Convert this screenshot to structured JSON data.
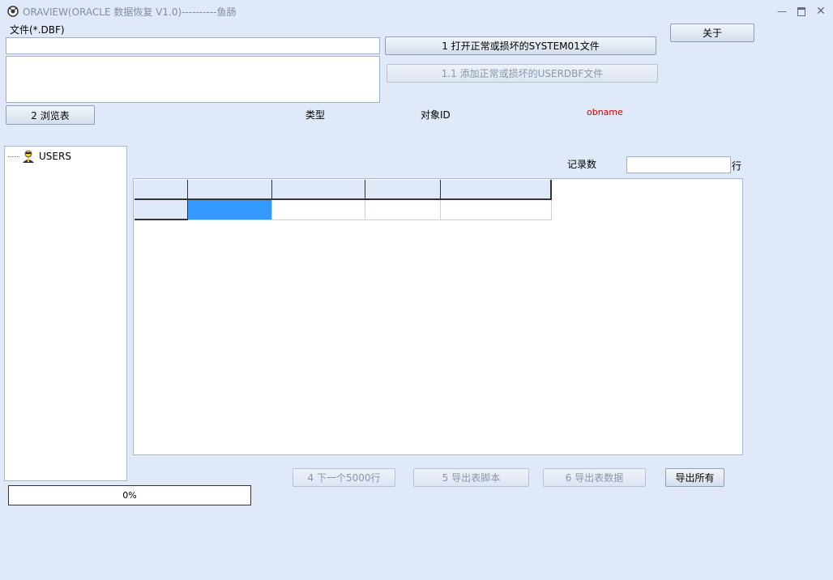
{
  "window": {
    "title": "ORAVIEW(ORACLE 数据恢复 V1.0)----------鱼肠"
  },
  "file_section": {
    "label": "文件(*.DBF)",
    "path_value": "",
    "list_value": ""
  },
  "buttons": {
    "open_system": "1 打开正常或损坏的SYSTEM01文件",
    "add_userdbf": "1.1 添加正常或损坏的USERDBF文件",
    "about": "关于",
    "browse_table": "2 浏览表",
    "next_5000": "4 下一个5000行",
    "export_script": "5 导出表脚本",
    "export_data": "6 导出表数据",
    "export_all": "导出所有"
  },
  "info": {
    "type_label": "类型",
    "object_id_label": "对象ID",
    "obname": "obname",
    "record_count_label": "记录数",
    "record_count_value": "",
    "rows_unit": "行"
  },
  "tree": {
    "root_label": "USERS"
  },
  "progress": {
    "percent": 0,
    "label": "0%"
  },
  "colors": {
    "accent": "#3399ff",
    "obname": "#cc0000",
    "background": "#dfe9f7"
  }
}
